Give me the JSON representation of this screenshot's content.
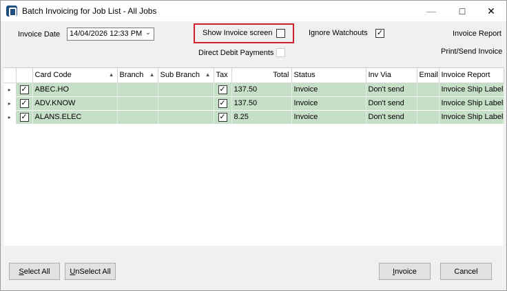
{
  "window": {
    "title": "Batch Invoicing for Job List - All Jobs"
  },
  "controls": {
    "invoice_date_label": "Invoice Date",
    "invoice_date_value": "14/04/2026 12:33 PM",
    "show_invoice_screen_label": "Show Invoice screen",
    "show_invoice_screen_checked": false,
    "ignore_watchouts_label": "Ignore Watchouts",
    "ignore_watchouts_checked": true,
    "direct_debit_label": "Direct Debit Payments",
    "direct_debit_checked": false,
    "invoice_report_label": "Invoice Report",
    "print_send_label": "Print/Send Invoice"
  },
  "grid": {
    "columns": [
      "Card Code",
      "Branch",
      "Sub Branch",
      "Tax",
      "Total",
      "Status",
      "Inv Via",
      "Email",
      "Invoice Report"
    ],
    "rows": [
      {
        "selected": true,
        "card_code": "ABEC.HO",
        "branch": "",
        "sub_branch": "",
        "tax": true,
        "total": "137.50",
        "status": "Invoice",
        "inv_via": "Don't send",
        "email": "",
        "invoice_report": "Invoice Ship Label"
      },
      {
        "selected": true,
        "card_code": "ADV.KNOW",
        "branch": "",
        "sub_branch": "",
        "tax": true,
        "total": "137.50",
        "status": "Invoice",
        "inv_via": "Don't send",
        "email": "",
        "invoice_report": "Invoice Ship Label"
      },
      {
        "selected": true,
        "card_code": "ALANS.ELEC",
        "branch": "",
        "sub_branch": "",
        "tax": true,
        "total": "8.25",
        "status": "Invoice",
        "inv_via": "Don't send",
        "email": "",
        "invoice_report": "Invoice Ship Label"
      }
    ]
  },
  "buttons": {
    "select_all_hotkey": "S",
    "select_all_rest": "elect All",
    "unselect_all_hotkey": "U",
    "unselect_all_rest": "nSelect All",
    "invoice_hotkey": "I",
    "invoice_rest": "nvoice",
    "cancel": "Cancel"
  }
}
